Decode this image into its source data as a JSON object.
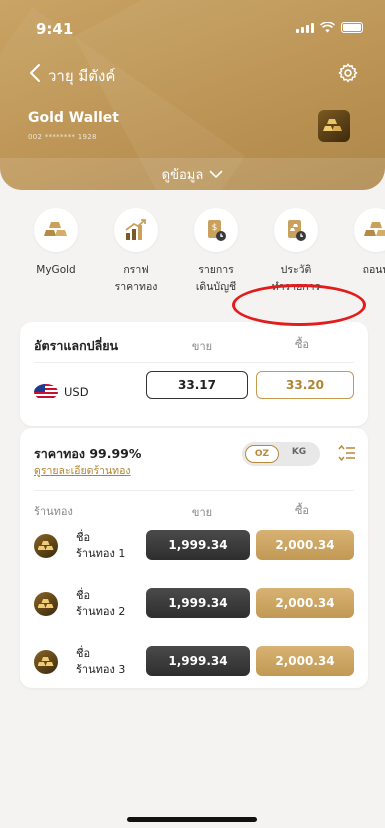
{
  "status_bar": {
    "time": "9:41"
  },
  "nav": {
    "user_name": "วายุ มีตังค์"
  },
  "wallet": {
    "title": "Gold Wallet",
    "account": "002 ******** 1928",
    "more_label": "ดูข้อมูล"
  },
  "menu": [
    {
      "label": "MyGold",
      "icon": "gold-bars-icon"
    },
    {
      "label": "กราฟ\nราคาทอง",
      "icon": "chart-icon"
    },
    {
      "label": "รายการ\nเดินบัญชี",
      "icon": "statement-icon"
    },
    {
      "label": "ประวัติ\nทำรายการ",
      "icon": "history-icon"
    },
    {
      "label": "ถอนท",
      "icon": "withdraw-icon"
    }
  ],
  "fx": {
    "title": "อัตราแลกปลี่ยน",
    "sell_header": "ขาย",
    "buy_header": "ซื้อ",
    "currency": "USD",
    "sell": "33.17",
    "buy": "33.20"
  },
  "gold_price": {
    "title": "ราคาทอง 99.99%",
    "link": "ดูรายละเอียดร้านทอง",
    "unit_options": [
      "OZ",
      "KG"
    ],
    "selected_unit": "OZ",
    "store_header": "ร้านทอง",
    "sell_header": "ขาย",
    "buy_header": "ซื้อ",
    "rows": [
      {
        "name_line1": "ชื่อ",
        "name_line2": "ร้านทอง 1",
        "sell": "1,999.34",
        "buy": "2,000.34"
      },
      {
        "name_line1": "ชื่อ",
        "name_line2": "ร้านทอง 2",
        "sell": "1,999.34",
        "buy": "2,000.34"
      },
      {
        "name_line1": "ชื่อ",
        "name_line2": "ร้านทอง 3",
        "sell": "1,999.34",
        "buy": "2,000.34"
      }
    ]
  },
  "colors": {
    "gold": "#c19954",
    "dark": "#2e2e2e",
    "highlight": "#e21c1c"
  }
}
